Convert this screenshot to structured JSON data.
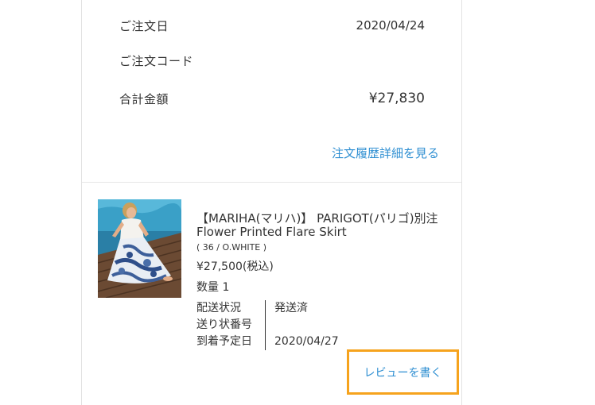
{
  "order_summary": {
    "order_date_label": "ご注文日",
    "order_date_value": "2020/04/24",
    "order_code_label": "ご注文コード",
    "order_code_value": "",
    "total_label": "合計金額",
    "total_value": "¥27,830",
    "detail_link": "注文履歴詳細を見る"
  },
  "product": {
    "brand_line": "【MARIHA(マリハ)】 PARIGOT(パリゴ)別注",
    "name_line": "Flower Printed Flare Skirt",
    "variant": "( 36 / O.WHITE )",
    "price": "¥27,500(税込)",
    "quantity": "数量 1",
    "image_icon": "product-photo"
  },
  "shipping": {
    "status_label": "配送状況",
    "status_value": "発送済",
    "tracking_label": "送り状番号",
    "tracking_value": "",
    "arrival_label": "到着予定日",
    "arrival_value": "2020/04/27"
  },
  "actions": {
    "review_button": "レビューを書く"
  },
  "colors": {
    "link": "#2f8fd2",
    "highlight_border": "#f6a31d",
    "text": "#333333",
    "border": "#e2e2e2"
  }
}
